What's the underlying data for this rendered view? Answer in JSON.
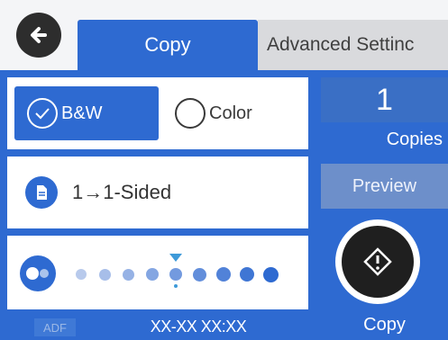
{
  "tabs": [
    {
      "label": "Copy",
      "active": true
    },
    {
      "label": "Advanced Settinc",
      "active": false
    }
  ],
  "color_mode": {
    "options": [
      {
        "label": "B&W",
        "selected": true
      },
      {
        "label": "Color",
        "selected": false
      }
    ]
  },
  "sided": {
    "label": "1→1-Sided"
  },
  "density": {
    "levels": 9,
    "selected_index": 4
  },
  "copies": {
    "value": "1",
    "label": "Copies"
  },
  "preview_label": "Preview",
  "start": {
    "label": "Copy"
  },
  "status": {
    "adf_label": "ADF",
    "datetime": "XX-XX XX:XX"
  },
  "colors": {
    "accent": "#2e6ad1",
    "tab_inactive": "#d9dadd",
    "marker": "#3e9ad9"
  },
  "icons": [
    "back-arrow-icon",
    "check-circle-icon",
    "document-icon",
    "density-icon",
    "start-diamond-icon"
  ]
}
